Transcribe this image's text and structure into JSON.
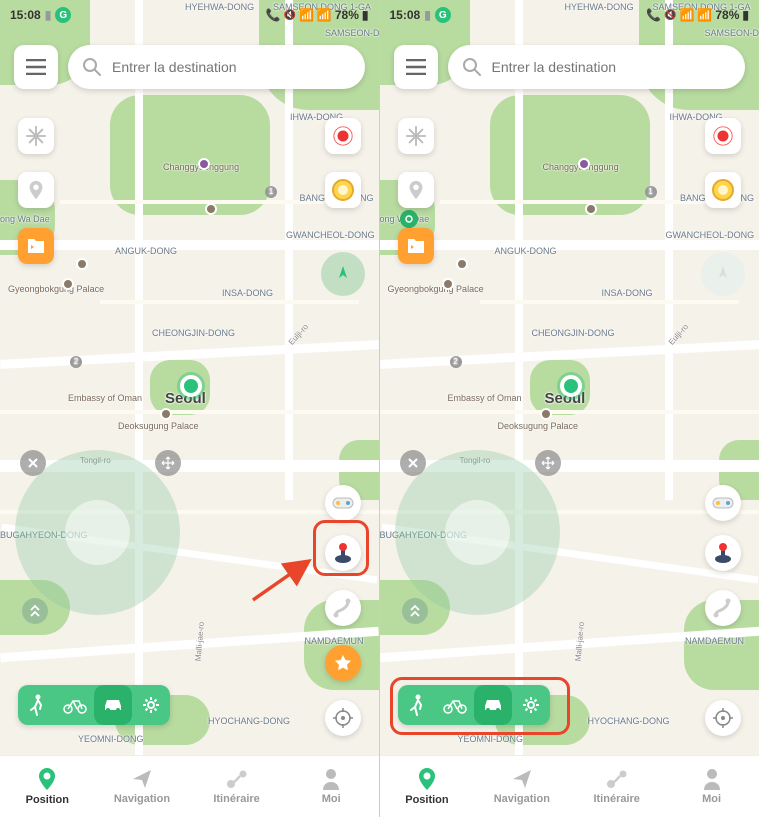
{
  "status": {
    "time": "15:08",
    "battery": "78%",
    "g_badge": "G"
  },
  "search": {
    "placeholder": "Entrer la destination"
  },
  "map_labels": {
    "samseon": "SAMSEON-DONG",
    "hyehwa": "HYEHWA-DONG",
    "samseon1": "SAMSEON DONG 1-GA",
    "ihwa": "IHWA-DONG",
    "changgyeong": "Changgyeonggung",
    "bangsan": "BANGSAN-DONG",
    "gwancheol": "GWANCHEOL-DONG",
    "anguk": "ANGUK-DONG",
    "ongwa": "ong Wa Dae",
    "gyeongbok": "Gyeongbokgung Palace",
    "insa": "INSA-DONG",
    "cheongjin": "CHEONGJIN-DONG",
    "seoul": "Seoul",
    "oman": "Embassy of Oman",
    "deoksu": "Deoksugung Palace",
    "tongil": "Tongil-ro",
    "eulji": "Eulji-ro",
    "bugahyeon": "BUGAHYEON-DONG",
    "namdae": "NAMDAEMUN",
    "malli": "Malli-jae-ro",
    "hyochang": "HYOCHANG-DONG",
    "yeomni": "YEOMNI-DONG",
    "n1": "1",
    "n2": "2"
  },
  "nav": {
    "position": "Position",
    "navigation": "Navigation",
    "itineraire": "Itinéraire",
    "moi": "Moi"
  },
  "icons": {
    "snowflake": "snowflake-icon",
    "location_gray": "location-gray-icon",
    "folder": "folder-icon",
    "record": "record-icon",
    "coin": "coin-icon",
    "gamepad": "gamepad-icon",
    "joystick": "joystick-icon",
    "route": "route-icon",
    "star": "star-icon",
    "target": "target-icon",
    "walk": "walk-icon",
    "bike": "bike-icon",
    "car": "car-icon",
    "gear": "gear-icon"
  },
  "highlights": {
    "left_target": "joystick-button",
    "right_target": "mode-bar"
  }
}
